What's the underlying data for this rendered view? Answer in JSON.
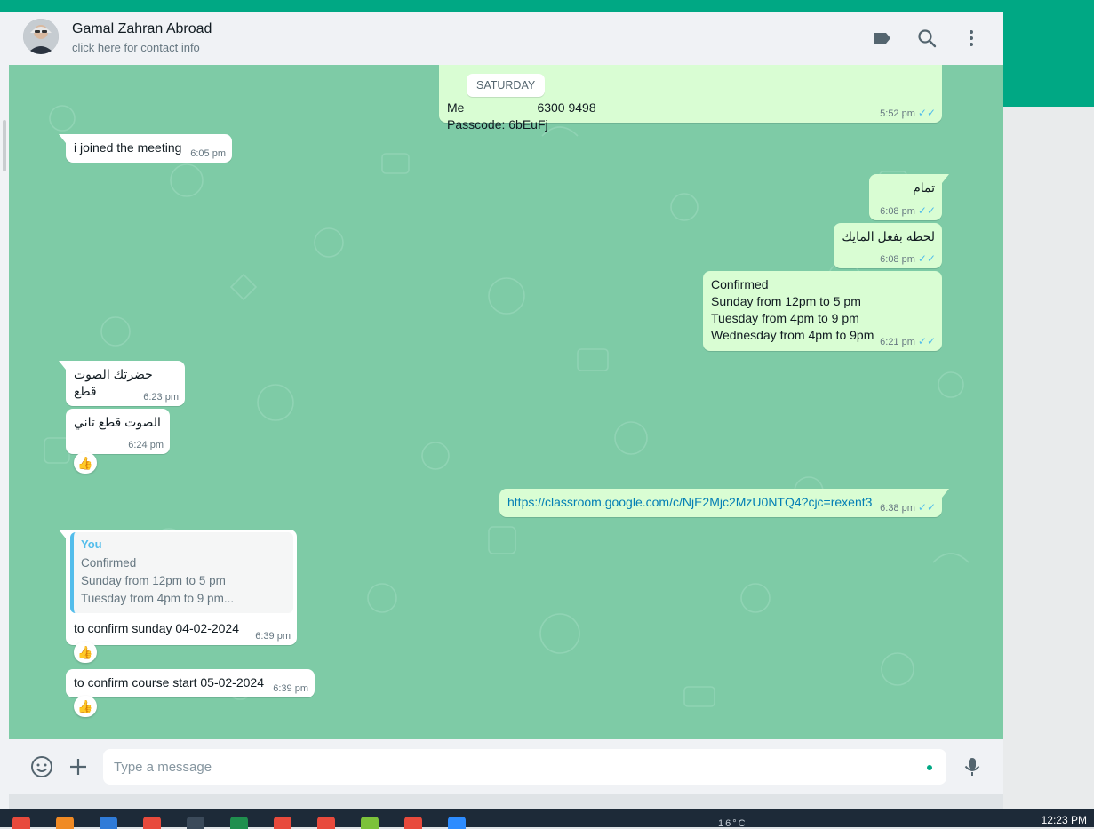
{
  "header": {
    "contact_name": "Gamal Zahran Abroad",
    "contact_sub": "click here for contact info",
    "icons": [
      "label-icon",
      "search-icon",
      "menu-icon"
    ]
  },
  "chat": {
    "date_chip": "SATURDAY",
    "messages": [
      {
        "id": "m1",
        "dir": "out",
        "line1_start": "Me",
        "line1_end": "6300 9498",
        "line2": "Passcode: 6bEuFj",
        "time": "5:52 pm"
      },
      {
        "id": "m2",
        "dir": "in",
        "text": "i joined the meeting",
        "time": "6:05 pm"
      },
      {
        "id": "m3",
        "dir": "out",
        "text": "تمام",
        "time": "6:08 pm"
      },
      {
        "id": "m4",
        "dir": "out",
        "text": "لحظة بفعل المايك",
        "time": "6:08 pm"
      },
      {
        "id": "m5",
        "dir": "out",
        "text": "Confirmed\nSunday from 12pm to 5 pm\nTuesday from 4pm to 9 pm\nWednesday from 4pm to 9pm",
        "time": "6:21 pm"
      },
      {
        "id": "m6",
        "dir": "in",
        "text": "حضرتك الصوت قطع",
        "time": "6:23 pm"
      },
      {
        "id": "m7",
        "dir": "in",
        "text": "الصوت قطع تاني",
        "time": "6:24 pm",
        "reaction": "👍"
      },
      {
        "id": "m8",
        "dir": "out",
        "text": "https://classroom.google.com/c/NjE2Mjc2MzU0NTQ4?cjc=rexent3",
        "time": "6:38 pm"
      },
      {
        "id": "m9",
        "dir": "in",
        "quote_author": "You",
        "quote_text": "Confirmed\nSunday from 12pm to 5 pm\nTuesday from 4pm to 9 pm...",
        "text": "to confirm sunday 04-02-2024",
        "time": "6:39 pm",
        "reaction": "👍"
      },
      {
        "id": "m10",
        "dir": "in",
        "text": "to confirm course start 05-02-2024",
        "time": "6:39 pm",
        "reaction": "👍"
      }
    ]
  },
  "composer": {
    "placeholder": "Type a message",
    "icons": [
      "emoji-icon",
      "plus-icon",
      "mic-icon"
    ]
  },
  "taskbar": {
    "clock": "12:23 PM",
    "tray_text": "16°C"
  },
  "colors": {
    "accent": "#00a884",
    "chat_bg": "#7ecba6",
    "outgoing_bubble": "#d9fdd3",
    "incoming_bubble": "#ffffff",
    "read_ticks": "#53bdeb"
  }
}
